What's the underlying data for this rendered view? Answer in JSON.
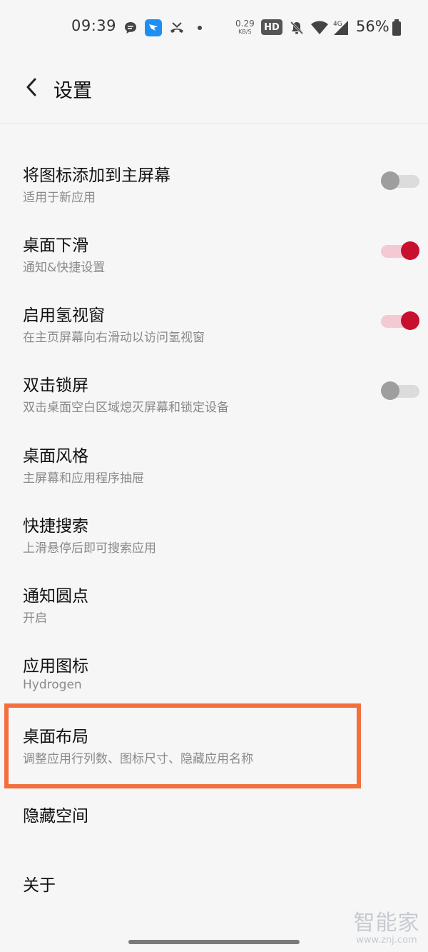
{
  "status_bar": {
    "time": "09:39",
    "net_speed_value": "0.29",
    "net_speed_unit": "KB/S",
    "hd_badge": "HD",
    "network_type": "4G",
    "battery_percent": "56%",
    "icons": [
      "message-bubble-icon",
      "dingtalk-icon",
      "missed-call-icon",
      "dot-icon",
      "hd-badge",
      "bell-off-icon",
      "wifi-icon",
      "cellular-signal-icon",
      "battery-icon"
    ]
  },
  "header": {
    "title": "设置",
    "back_icon": "chevron-left-icon"
  },
  "settings": [
    {
      "title": "将图标添加到主屏幕",
      "subtitle": "适用于新应用",
      "toggle": "off"
    },
    {
      "title": "桌面下滑",
      "subtitle": "通知&快捷设置",
      "toggle": "on"
    },
    {
      "title": "启用氢视窗",
      "subtitle": "在主页屏幕向右滑动以访问氢视窗",
      "toggle": "on"
    },
    {
      "title": "双击锁屏",
      "subtitle": "双击桌面空白区域熄灭屏幕和锁定设备",
      "toggle": "off"
    },
    {
      "title": "桌面风格",
      "subtitle": "主屏幕和应用程序抽屉"
    },
    {
      "title": "快捷搜索",
      "subtitle": "上滑悬停后即可搜索应用"
    },
    {
      "title": "通知圆点",
      "subtitle": "开启"
    },
    {
      "title": "应用图标",
      "subtitle": "Hydrogen"
    },
    {
      "title": "桌面布局",
      "subtitle": "调整应用行列数、图标尺寸、隐藏应用名称",
      "highlighted": true
    },
    {
      "title": "隐藏空间"
    },
    {
      "title": "关于"
    }
  ],
  "colors": {
    "toggle_on_knob": "#c8102e",
    "toggle_on_track": "#f5c9d3",
    "toggle_off_knob": "#9e9e9e",
    "toggle_off_track": "#dcdcdc",
    "highlight_border": "#f36f3d"
  },
  "watermark": {
    "brand": "智能家",
    "url": "www.znj.com"
  }
}
